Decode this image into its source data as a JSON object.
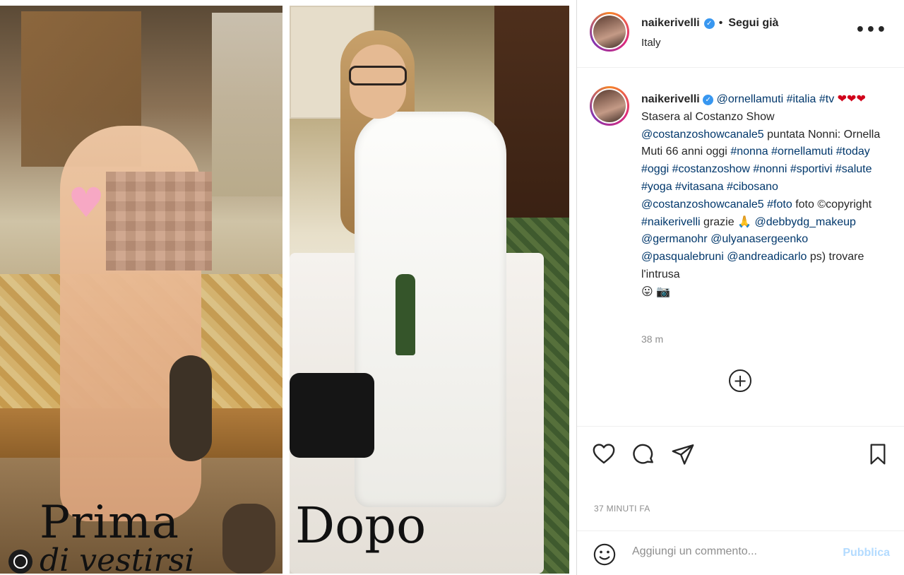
{
  "post": {
    "left_caption_line1": "Prima",
    "left_caption_line2": "di vestirsi",
    "right_caption": "Dopo"
  },
  "header": {
    "username": "naikerivelli",
    "verified_icon": "✓",
    "separator": "•",
    "follow_label": "Segui già",
    "location": "Italy",
    "more_label": "•••"
  },
  "comment": {
    "username": "naikerivelli",
    "text_parts": {
      "p1": "@ornellamuti",
      "p2": "#italia",
      "p3": "#tv",
      "hearts": "❤❤❤",
      "p4": "Stasera al Costanzo Show",
      "p5": "@costanzoshowcanale5",
      "p6": "puntata Nonni: Ornella Muti 66 anni oggi",
      "p7": "#nonna",
      "p8": "#ornellamuti",
      "p9": "#today",
      "p10": "#oggi",
      "p11": "#costanzoshow",
      "p12": "#nonni",
      "p13": "#sportivi",
      "p14": "#salute",
      "p15": "#yoga",
      "p16": "#vitasana",
      "p17": "#cibosano",
      "p18": "@costanzoshowcanale5",
      "p19": "#foto",
      "p20": "foto ©copyright",
      "p21": "#naikerivelli",
      "p22": "grazie 🙏",
      "p23": "@debbydg_makeup",
      "p24": "@germanohr",
      "p25": "@ulyanasergeenko",
      "p26": "@pasqualebruni",
      "p27": "@andreadicarlo",
      "p28": "ps) trovare l'intrusa",
      "p29": "😛 📷"
    },
    "time": "38 m",
    "load_more_label": "+"
  },
  "actions": {
    "like_icon": "heart-icon",
    "comment_icon": "comment-icon",
    "share_icon": "paper-plane-icon",
    "save_icon": "bookmark-icon",
    "timestamp": "37 MINUTI FA"
  },
  "add_comment": {
    "placeholder": "Aggiungi un commento...",
    "publish_label": "Pubblica"
  },
  "colors": {
    "link": "#00376b",
    "verified": "#3897f0",
    "publish_disabled": "#b3dbff",
    "muted": "#8e8e8e"
  }
}
